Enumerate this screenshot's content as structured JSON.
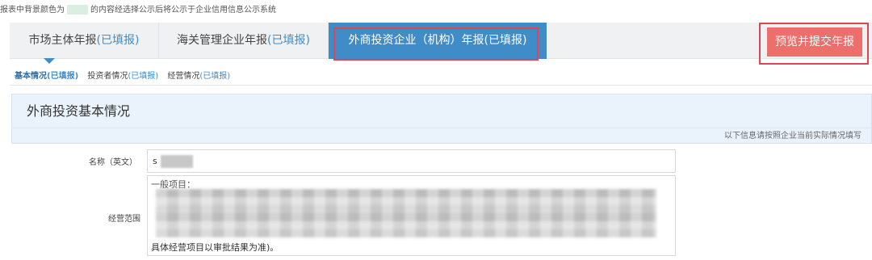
{
  "notice": {
    "before": "报表中背景颜色为",
    "after": "的内容经选择公示后将公示于企业信用信息公示系统"
  },
  "tabs": [
    {
      "label": "市场主体年报",
      "status": "(已填报)"
    },
    {
      "label": "海关管理企业年报",
      "status": "(已填报)"
    },
    {
      "label": "外商投资企业（机构）年报",
      "status": "(已填报)"
    }
  ],
  "preview_button": "预览并提交年报",
  "subtabs": [
    {
      "label": "基本情况",
      "status": "(已填报)"
    },
    {
      "label": "投资者情况",
      "status": "(已填报)"
    },
    {
      "label": "经营情况",
      "status": "(已填报)"
    }
  ],
  "section": {
    "title": "外商投资基本情况",
    "hint": "以下信息请按照企业当前实际情况填写"
  },
  "form": {
    "name_label": "名称（英文）",
    "name_value": "s",
    "scope_label": "经营范围",
    "scope_text_start": "一般项目：",
    "scope_text_end": "具体经营项目以审批结果为准)。"
  },
  "colors": {
    "accent": "#3f8cc9",
    "highlight_border": "#e0464f",
    "preview_button": "#ec6f6c",
    "section_bg": "#eaf3fb"
  }
}
